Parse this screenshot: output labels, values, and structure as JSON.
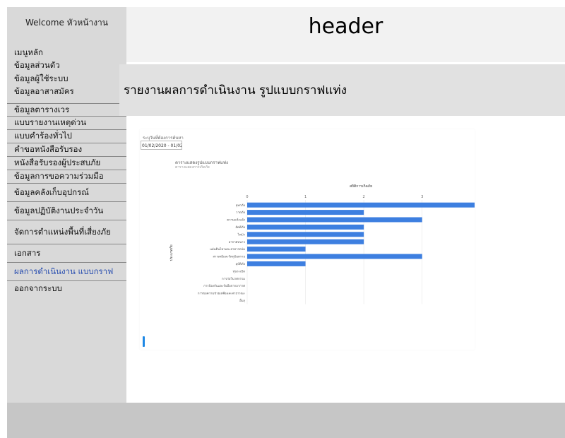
{
  "sidebar": {
    "welcome": "Welcome หัวหน้างาน",
    "plain_items": [
      "เมนูหลัก",
      "ข้อมูลส่วนตัว",
      "ข้อมูลผู้ใช้ระบบ",
      "ข้อมูลอาสาสมัคร"
    ],
    "boxed_items": [
      "ข้อมูลตารางเวร",
      "แบบรายงานเหตุด่วน",
      "แบบคำร้องทั่วไป",
      "คำขอหนังสือรับรอง",
      "หนังสือรับรองผู้ประสบภัย",
      "ข้อมูลการขอความร่วมมือ",
      "ข้อมูลคลังเก็บอุปกรณ์",
      "ข้อมูลปฏิบัติงานประจำวัน",
      "จัดการตำแหน่งพื้นที่เสี่ยงภัย",
      "เอกสาร",
      "ผลการดำเนินงาน แบบกราฟ",
      "ออกจากระบบ"
    ],
    "active_index": 10
  },
  "header": {
    "title": "header"
  },
  "report": {
    "title": "รายงานผลการดำเนินงาน รูปแบบกราฟแท่ง"
  },
  "filter": {
    "label": "ระบุวันที่ต้องการค้นหา",
    "value": "01/02/2020 - 01/02/2020"
  },
  "chart_data": {
    "type": "bar",
    "orientation": "horizontal",
    "title": "ตารางแสดงรูปแบบกราฟแท่ง",
    "subtitle": "ตารางแสดงการเกิดภัย",
    "xlabel": "สถิติการเกิดภัย",
    "ylabel": "ประเภทภัย",
    "xlim": [
      0,
      3.9
    ],
    "xticks": [
      0,
      1,
      2,
      3
    ],
    "grid": true,
    "categories": [
      "อุทกภัย",
      "วาตภัย",
      "ความแห้งแล้ง",
      "อัคคีภัย",
      "ไฟป่า",
      "อากาศหนาว",
      "แผ่นดินไหวและอาคารถล่ม",
      "สารเคมีและวัตถุอันตราย",
      "อุบัติภัย",
      "ทุ่นระเบิด",
      "การก่อวินาศกรรม",
      "การป้องกันและรับมือจากอากาศ",
      "การขอความช่วยเหลือและสาธารณะ",
      "อื่นๆ"
    ],
    "values": [
      3.9,
      2,
      3,
      2,
      2,
      2,
      1,
      3,
      1,
      0,
      0,
      0,
      0,
      0
    ],
    "bar_color": "#3d7fe0"
  },
  "colors": {
    "accent": "#1e88e5",
    "active_menu": "#2a4fb0"
  }
}
